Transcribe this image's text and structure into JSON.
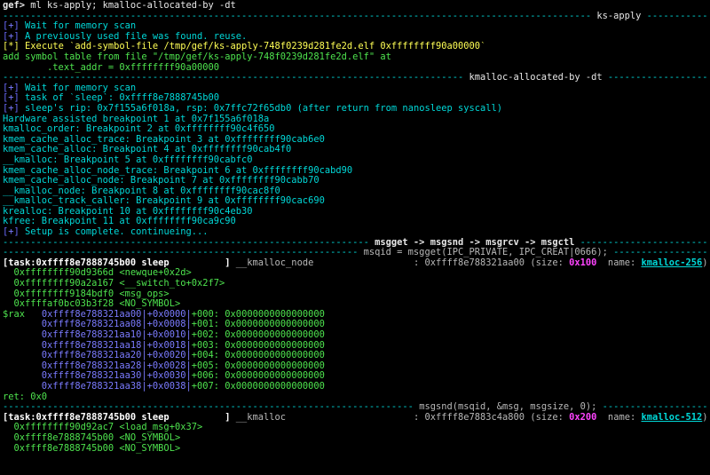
{
  "prompt": {
    "host": "gef>",
    "command": " ml ks-apply; kmalloc-allocated-by -dt"
  },
  "sections": {
    "ks_apply": "ks-apply",
    "kmalloc_alloc": "kmalloc-allocated-by -dt",
    "msg_ops": "msgget -> msgsnd -> msgrcv -> msgctl",
    "msgget_call": "msqid = msgget(IPC_PRIVATE, IPC_CREAT|0666);",
    "msgsnd_call": "msgsnd(msqid, &msg, msgsize, 0);"
  },
  "lines": {
    "wait1": "Wait for memory scan",
    "reuse": "A previously used file was found. reuse.",
    "execute": "Execute `add-symbol-file /tmp/gef/ks-apply-748f0239d281fe2d.elf 0xffffffff90a00000`",
    "addsym": "add symbol table from file \"/tmp/gef/ks-apply-748f0239d281fe2d.elf\" at",
    "textaddr": "        .text_addr = 0xffffffff90a00000",
    "wait2": "Wait for memory scan",
    "task_sleep": "task of `sleep`: 0xffff8e7888745b00",
    "sleep_rip": "sleep's rip: 0x7f155a6f018a, rsp: 0x7ffc72f65db0 (after return from nanosleep syscall)",
    "hw_bp": "Hardware assisted breakpoint 1 at 0x7f155a6f018a",
    "bp2": "kmalloc_order: Breakpoint 2 at 0xffffffff90c4f650",
    "bp3": "kmem_cache_alloc_trace: Breakpoint 3 at 0xffffffff90cab6e0",
    "bp4": "kmem_cache_alloc: Breakpoint 4 at 0xffffffff90cab4f0",
    "bp5": "__kmalloc: Breakpoint 5 at 0xffffffff90cabfc0",
    "bp6": "kmem_cache_alloc_node_trace: Breakpoint 6 at 0xffffffff90cabd90",
    "bp7": "kmem_cache_alloc_node: Breakpoint 7 at 0xffffffff90cabb70",
    "bp8": "__kmalloc_node: Breakpoint 8 at 0xffffffff90cac8f0",
    "bp9": "__kmalloc_track_caller: Breakpoint 9 at 0xffffffff90cac690",
    "bp10": "krealloc: Breakpoint 10 at 0xffffffff90c4eb30",
    "bp11": "kfree: Breakpoint 11 at 0xffffffff90ca9c90",
    "setup": "Setup is complete. continueing..."
  },
  "marker": "+",
  "marker_star": "*",
  "alloc1": {
    "task": "[task:0xffff8e7888745b00 sleep          ]",
    "func": "__kmalloc_node",
    "addr": ": 0xffff8e788321aa00",
    "size_label": "(size: ",
    "size": "0x100",
    "name_label": "  name: ",
    "name": "kmalloc-256",
    "name_close": ")",
    "trace": [
      {
        "addr": "0xffffffff90d9366d",
        "sym": "<newque+0x2d>"
      },
      {
        "addr": "0xffffffff90a2a167",
        "sym": "<__switch_to+0x2f7>"
      },
      {
        "addr": "0xffffffff9184bdf0",
        "sym": "<msg_ops>"
      },
      {
        "addr": "0xffffaf0bc03b3f28",
        "sym": "<NO_SYMBOL>"
      }
    ],
    "rax": "$rax",
    "dump": [
      {
        "addr": "0xffff8e788321aa00",
        "off": "+0x0000",
        "idx": "+000:",
        "val": "0x0000000000000000"
      },
      {
        "addr": "0xffff8e788321aa08",
        "off": "+0x0008",
        "idx": "+001:",
        "val": "0x0000000000000000"
      },
      {
        "addr": "0xffff8e788321aa10",
        "off": "+0x0010",
        "idx": "+002:",
        "val": "0x0000000000000000"
      },
      {
        "addr": "0xffff8e788321aa18",
        "off": "+0x0018",
        "idx": "+003:",
        "val": "0x0000000000000000"
      },
      {
        "addr": "0xffff8e788321aa20",
        "off": "+0x0020",
        "idx": "+004:",
        "val": "0x0000000000000000"
      },
      {
        "addr": "0xffff8e788321aa28",
        "off": "+0x0028",
        "idx": "+005:",
        "val": "0x0000000000000000"
      },
      {
        "addr": "0xffff8e788321aa30",
        "off": "+0x0030",
        "idx": "+006:",
        "val": "0x0000000000000000"
      },
      {
        "addr": "0xffff8e788321aa38",
        "off": "+0x0038",
        "idx": "+007:",
        "val": "0x0000000000000000"
      }
    ],
    "ret": "ret: 0x0"
  },
  "alloc2": {
    "task": "[task:0xffff8e7888745b00 sleep          ]",
    "func": "__kmalloc",
    "addr": ": 0xffff8e7883c4a800",
    "size_label": "(size: ",
    "size": "0x200",
    "name_label": "  name: ",
    "name": "kmalloc-512",
    "name_close": ")",
    "trace": [
      {
        "addr": "0xffffffff90d92ac7",
        "sym": "<load_msg+0x37>"
      },
      {
        "addr": "0xffff8e7888745b00",
        "sym": "<NO_SYMBOL>"
      },
      {
        "addr": "0xffff8e7888745b00",
        "sym": "<NO_SYMBOL>"
      }
    ]
  },
  "colors": {
    "background": "#000000",
    "cyan": "#00d8d8",
    "green": "#4ee34e",
    "blue": "#7b7bff",
    "yellow": "#ffff55",
    "magenta": "#ff44ff",
    "white": "#e8e8e8"
  }
}
